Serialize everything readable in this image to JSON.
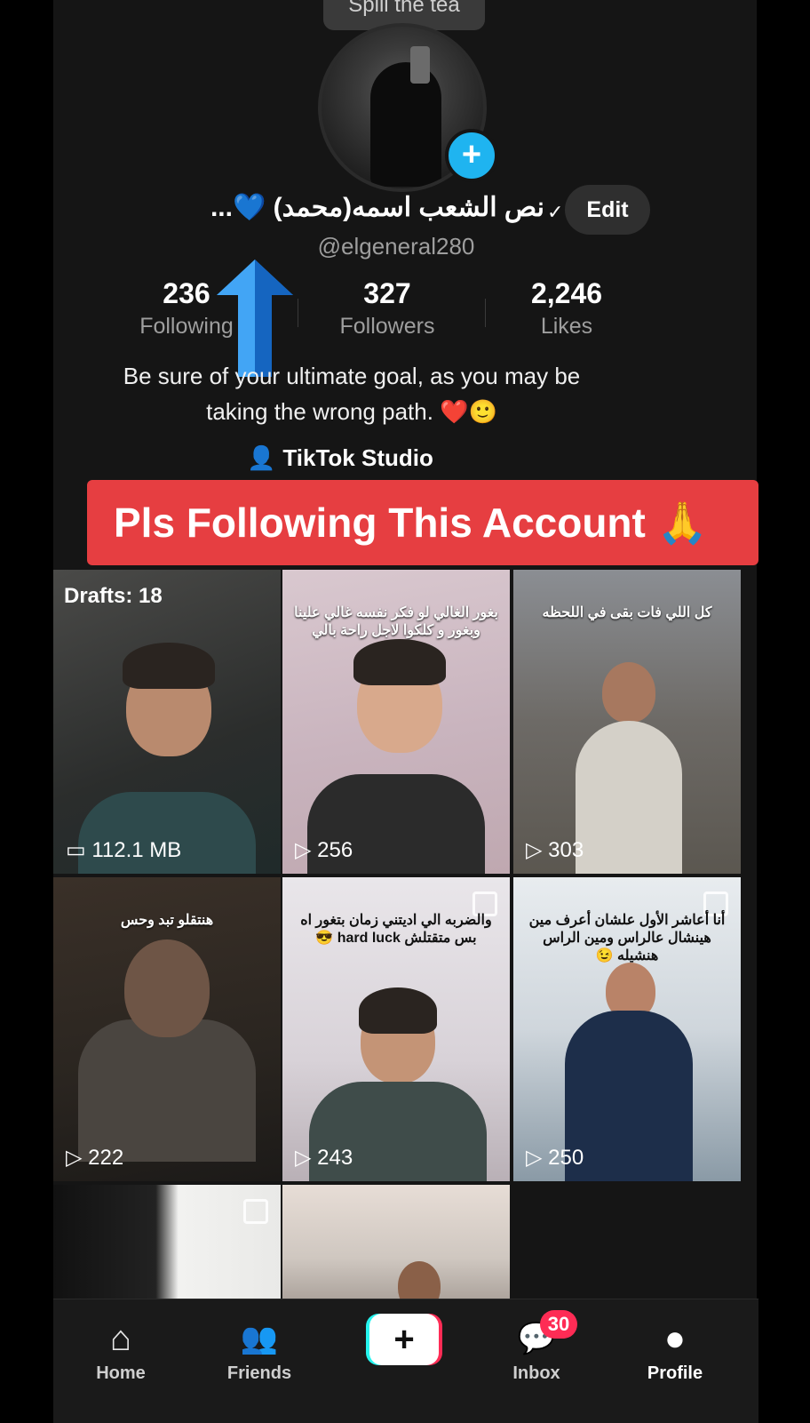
{
  "top_pill": "Spill the tea",
  "profile": {
    "display_name": "نص الشعب اسمه(محمد) 💙...",
    "username": "@elgeneral280",
    "edit_label": "Edit",
    "bio_line1": "Be sure of your ultimate goal, as you may be",
    "bio_line2": "taking the wrong path. ❤️🙂",
    "studio_label": "TikTok Studio"
  },
  "stats": [
    {
      "value": "236",
      "label": "Following"
    },
    {
      "value": "327",
      "label": "Followers"
    },
    {
      "value": "2,246",
      "label": "Likes"
    }
  ],
  "banner": "Pls Following This Account 🙏",
  "grid": {
    "drafts_label": "Drafts: 18",
    "items": [
      {
        "meta": "112.1 MB"
      },
      {
        "meta": "256",
        "caption": "بغور الغالي لو فكر نفسه غالي علينا وبغور و كلكوا لاجل راحة بالي"
      },
      {
        "meta": "303",
        "caption": "كل اللي فات بقى في اللحظه"
      },
      {
        "meta": "222",
        "caption": "هنتقلو تبد وحس"
      },
      {
        "meta": "243",
        "caption": "والضربه الي اديتني زمان بتغور اه بس متقتلش hard luck 😎"
      },
      {
        "meta": "250",
        "caption": "أنا أعاشر الأول علشان أعرف مين هينشال عالراس ومين الراس هنشيله 😉"
      },
      {
        "meta": ""
      },
      {
        "meta": ""
      }
    ]
  },
  "nav": {
    "home": "Home",
    "friends": "Friends",
    "inbox": "Inbox",
    "inbox_badge": "30",
    "profile": "Profile"
  },
  "colors": {
    "accent_red": "#fe2c55",
    "accent_cyan": "#25f4ee",
    "banner_red": "#e63e41",
    "add_blue": "#1fb4f0"
  }
}
